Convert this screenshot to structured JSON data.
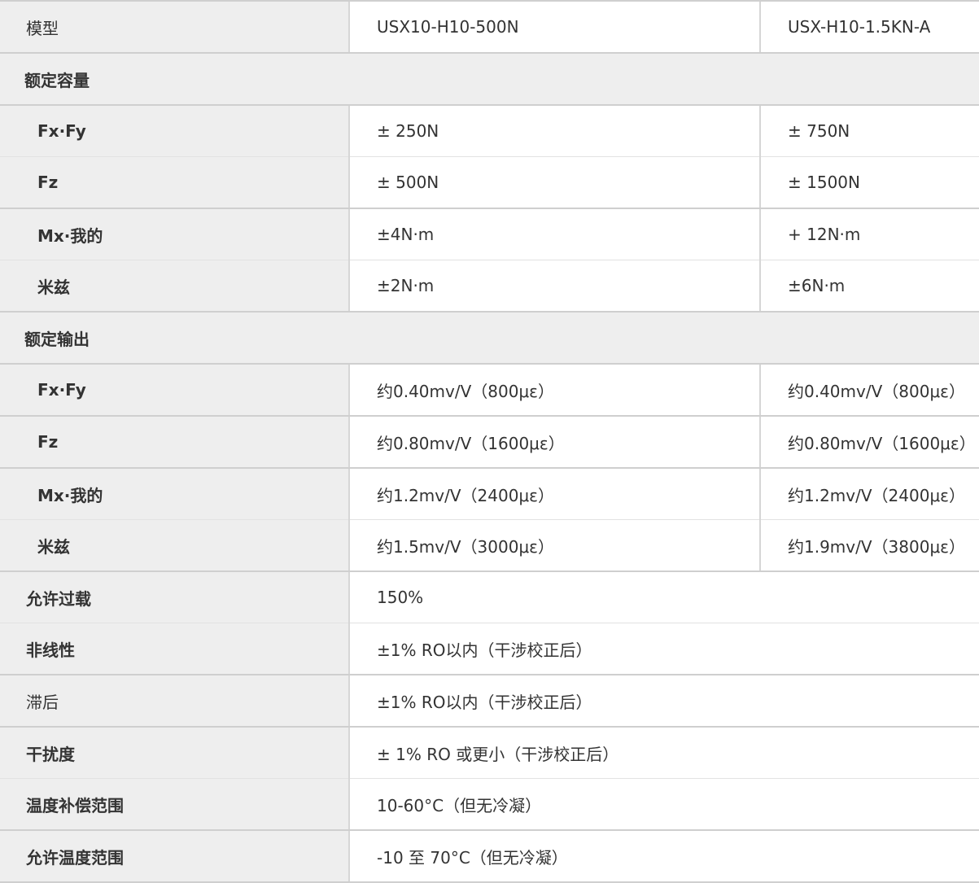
{
  "table": {
    "header": {
      "label": "模型",
      "col1": "USX10-H10-500N",
      "col2": "USX-H10-1.5KN-A"
    },
    "rated_capacity": {
      "title": "额定容量",
      "rows": [
        {
          "label": "Fx·Fy",
          "col1": "± 250N",
          "col2": "± 750N"
        },
        {
          "label": "Fz",
          "col1": "± 500N",
          "col2": "± 1500N"
        },
        {
          "label": "Mx·我的",
          "col1": "±4N·m",
          "col2": "+ 12N·m"
        },
        {
          "label": "米兹",
          "col1": "±2N·m",
          "col2": "±6N·m"
        }
      ]
    },
    "rated_output": {
      "title": "额定输出",
      "rows": [
        {
          "label": "Fx·Fy",
          "col1": "约0.40mv/V（800με）",
          "col2": "约0.40mv/V（800με）"
        },
        {
          "label": "Fz",
          "col1": "约0.80mv/V（1600με）",
          "col2": "约0.80mv/V（1600με）"
        },
        {
          "label": "Mx·我的",
          "col1": "约1.2mv/V（2400με）",
          "col2": "约1.2mv/V（2400με）"
        },
        {
          "label": "米兹",
          "col1": "约1.5mv/V（3000με）",
          "col2": "约1.9mv/V（3800με）"
        }
      ]
    },
    "other_rows": [
      {
        "label": "允许过载",
        "value": "150%"
      },
      {
        "label": "非线性",
        "value": "±1% RO以内（干涉校正后）"
      },
      {
        "label": "滞后",
        "value": "±1% RO以内（干涉校正后）"
      },
      {
        "label": "干扰度",
        "value": "± 1% RO 或更小（干涉校正后）"
      },
      {
        "label": "温度补偿范围",
        "value": "10-60°C（但无冷凝）"
      },
      {
        "label": "允许温度范围",
        "value": "-10 至 70°C（但无冷凝）"
      }
    ]
  }
}
